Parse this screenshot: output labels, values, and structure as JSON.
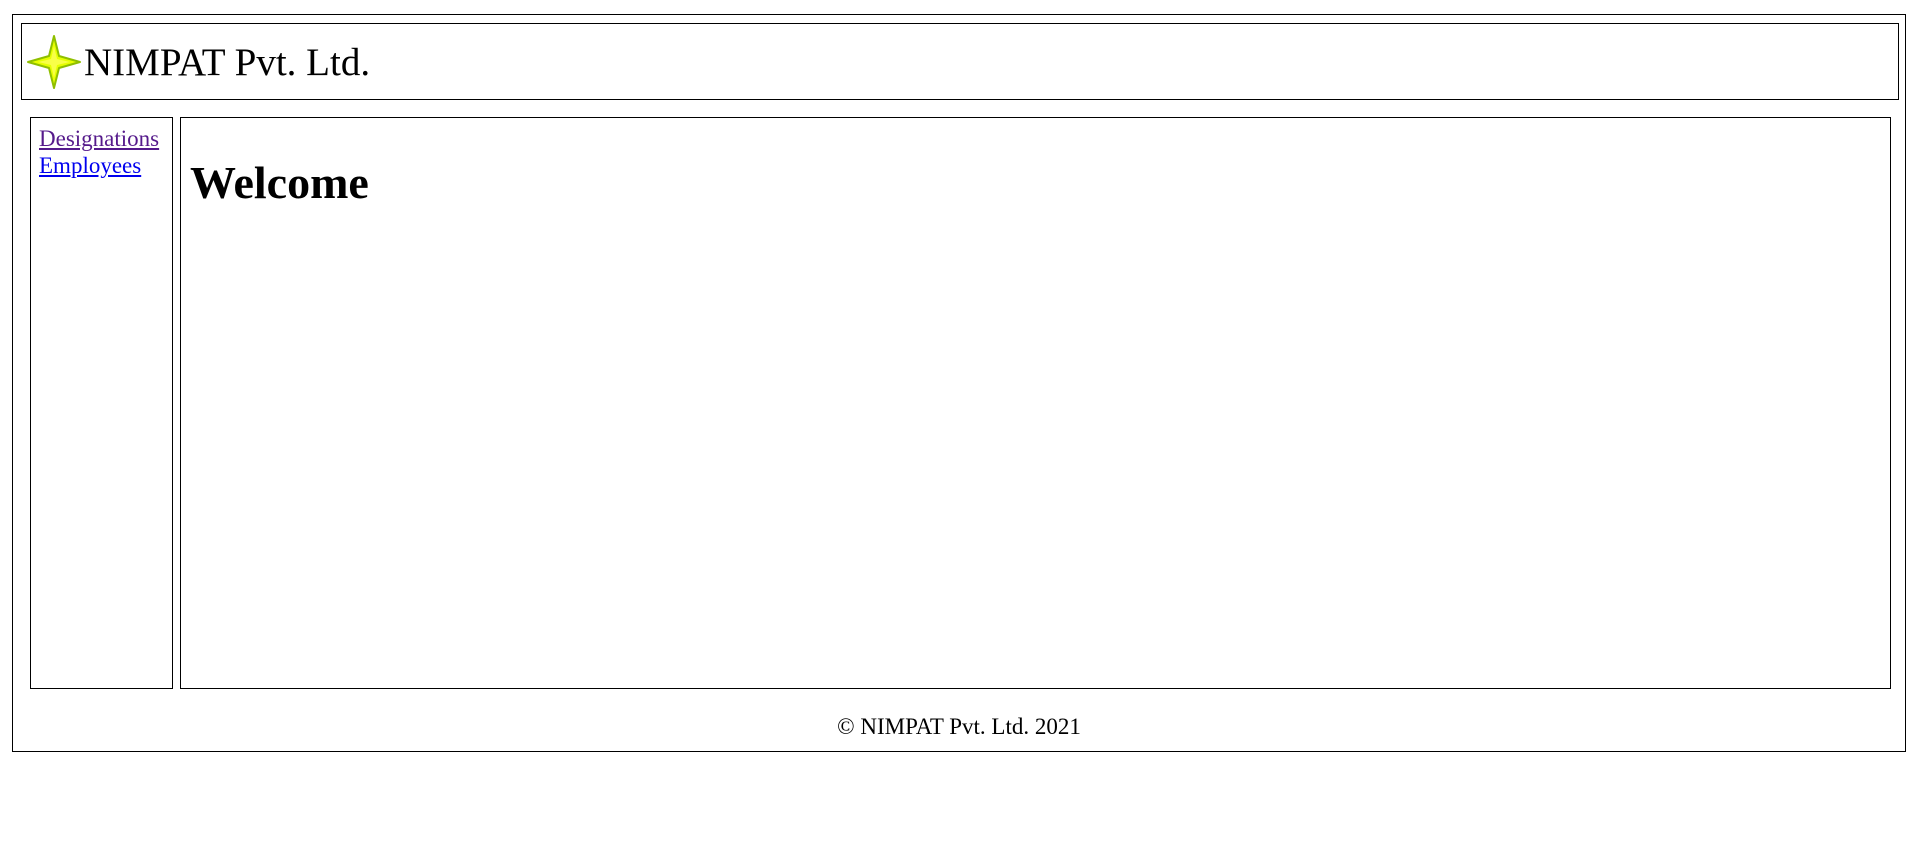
{
  "header": {
    "company_name": "NIMPAT Pvt. Ltd.",
    "logo_icon": "four-point-star-icon",
    "logo_color": "#e6ff00"
  },
  "sidebar": {
    "items": [
      {
        "label": "Designations",
        "visited": true
      },
      {
        "label": "Employees",
        "visited": false
      }
    ]
  },
  "main": {
    "heading": "Welcome"
  },
  "footer": {
    "copyright": "© NIMPAT Pvt. Ltd. 2021"
  }
}
